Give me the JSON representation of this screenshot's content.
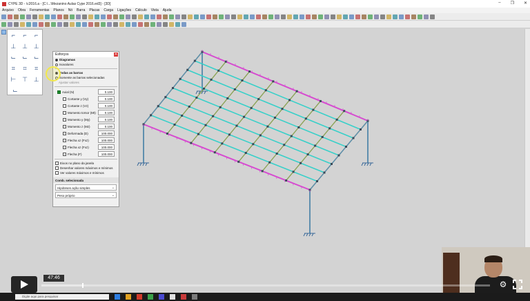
{
  "window": {
    "title": "CYPE 3D - \\c2016.a - [C:\\...\\Mezanino Aulas Cype 2016.ed3] - [3D]",
    "controls": [
      "–",
      "❐",
      "✕"
    ]
  },
  "menubar": {
    "items": [
      "Arquivo",
      "Obra",
      "Ferramentas",
      "Planos",
      "Nó",
      "Barra",
      "Placas",
      "Carga",
      "Ligações",
      "Cálculo",
      "Vista",
      "Ajuda"
    ]
  },
  "panel": {
    "title": "Esforços",
    "radio_diagramas": "Diagramas",
    "radio_isovalores": "Isovalores",
    "radio_todas": "Todas as barras",
    "radio_selecionadas": "Somente as barras selecionadas",
    "ajustar_valores": "Ajustar valores",
    "items": [
      {
        "label": "Axial (N)",
        "value": "0.100",
        "checked": true
      },
      {
        "label": "Cortante y (Vy)",
        "value": "0.100",
        "checked": false
      },
      {
        "label": "Cortante z (Vz)",
        "value": "0.100",
        "checked": false
      },
      {
        "label": "Momento torsor (Mt)",
        "value": "0.100",
        "checked": false
      },
      {
        "label": "Momento y (My)",
        "value": "0.100",
        "checked": false
      },
      {
        "label": "Momento z (Mz)",
        "value": "0.100",
        "checked": false
      },
      {
        "label": "Deformada (D)",
        "value": "100.000",
        "checked": false
      },
      {
        "label": "Flecha xz (Fxz)",
        "value": "100.000",
        "checked": false
      },
      {
        "label": "Flecha xz (Fxz)",
        "value": "100.000",
        "checked": false
      },
      {
        "label": "Flecha (F)",
        "value": "100.000",
        "checked": false
      }
    ],
    "options": [
      "Eixos no plano da janela",
      "Desenhar valores máximos e mínimos",
      "Ver valores máximos e mínimos"
    ],
    "combo_title": "Comb. selecionada",
    "select_1": "Hipóteses ação simples",
    "select_2": "Peso próprio"
  },
  "player": {
    "timestamp": "47:46",
    "progress": 0.09,
    "settings_icon": "gear-icon",
    "fullscreen_icon": "fullscreen-icon",
    "play_icon": "play-icon"
  },
  "taskbar": {
    "search_placeholder": "Digite aqui para pesquisar"
  },
  "colors": {
    "beam_magenta": "#d64bd0",
    "beam_cyan": "#37d0c9",
    "beam_olive": "#8ca457",
    "column_blue": "#5f8fae",
    "viewport_bg": "#d3d3d3"
  }
}
